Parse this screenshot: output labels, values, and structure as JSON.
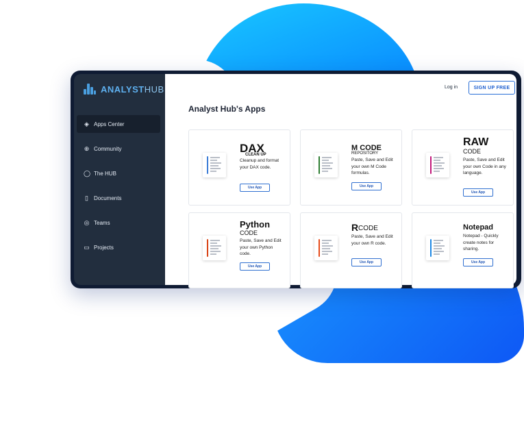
{
  "brand": {
    "name_bold": "ANALYST",
    "name_thin": "HUB",
    "accent": "#5eb0ef"
  },
  "header": {
    "login_label": "Log in",
    "signup_label": "SIGN UP FREE"
  },
  "page": {
    "title": "Analyst Hub's Apps"
  },
  "sidebar": {
    "items": [
      {
        "label": "Apps Center",
        "icon": "layers-icon",
        "glyph": "◈",
        "active": true
      },
      {
        "label": "Community",
        "icon": "globe-icon",
        "glyph": "⊕",
        "active": false
      },
      {
        "label": "The HUB",
        "icon": "chat-icon",
        "glyph": "◯",
        "active": false
      },
      {
        "label": "Documents",
        "icon": "document-icon",
        "glyph": "▯",
        "active": false
      },
      {
        "label": "Teams",
        "icon": "user-icon",
        "glyph": "◎",
        "active": false
      },
      {
        "label": "Projects",
        "icon": "folder-icon",
        "glyph": "▭",
        "active": false
      }
    ]
  },
  "apps": [
    {
      "title": "DAX",
      "subtitle": "CLEAN UP",
      "description": "Cleanup and format your DAX code.",
      "button": "Use App",
      "stripe": "#3a7bd5"
    },
    {
      "title": "M CODE",
      "subtitle": "REPOSITORY",
      "description": "Paste, Save and Edit your own M Code formulas.",
      "button": "Use App",
      "stripe": "#2e7d32"
    },
    {
      "title": "RAW",
      "subtitle": "CODE",
      "description": "Paste, Save and Edit your own Code in any language.",
      "button": "Use App",
      "stripe": "#c2187a"
    },
    {
      "title": "Python",
      "subtitle": "CODE",
      "description": "Paste, Save and Edit your own Python code.",
      "button": "Use App",
      "stripe": "#d84315"
    },
    {
      "title": "R",
      "subtitle": "CODE",
      "description": "Paste, Save and Edit your own R code.",
      "button": "Use App",
      "stripe": "#e64a19"
    },
    {
      "title": "Notepad",
      "subtitle": "",
      "description": "Notepad - Quickly create notes for sharing.",
      "button": "Use App",
      "stripe": "#1e88e5"
    }
  ]
}
